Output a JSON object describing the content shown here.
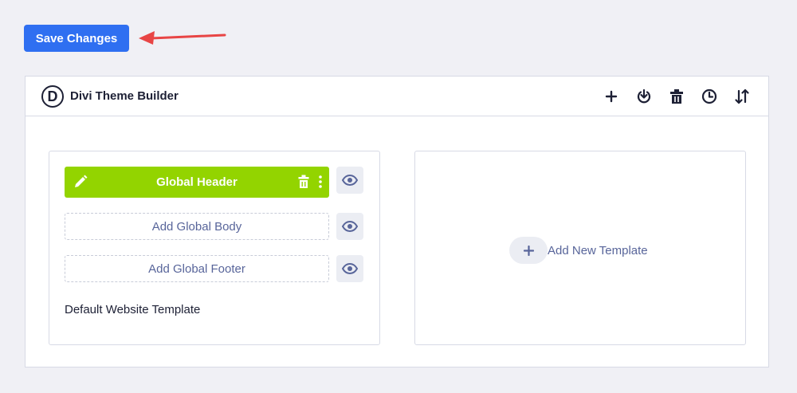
{
  "toolbar": {
    "save_label": "Save Changes"
  },
  "builder": {
    "logo_letter": "D",
    "title": "Divi Theme Builder",
    "actions": [
      "plus-icon",
      "portability-icon",
      "trash-icon",
      "history-icon",
      "sort-icon"
    ]
  },
  "default_template": {
    "header_label": "Global Header",
    "body_label": "Add Global Body",
    "footer_label": "Add Global Footer",
    "name": "Default Website Template"
  },
  "new_template": {
    "label": "Add New Template"
  },
  "colors": {
    "primary": "#2f6ff1",
    "header_green": "#93d400",
    "arrow": "#e84545"
  }
}
